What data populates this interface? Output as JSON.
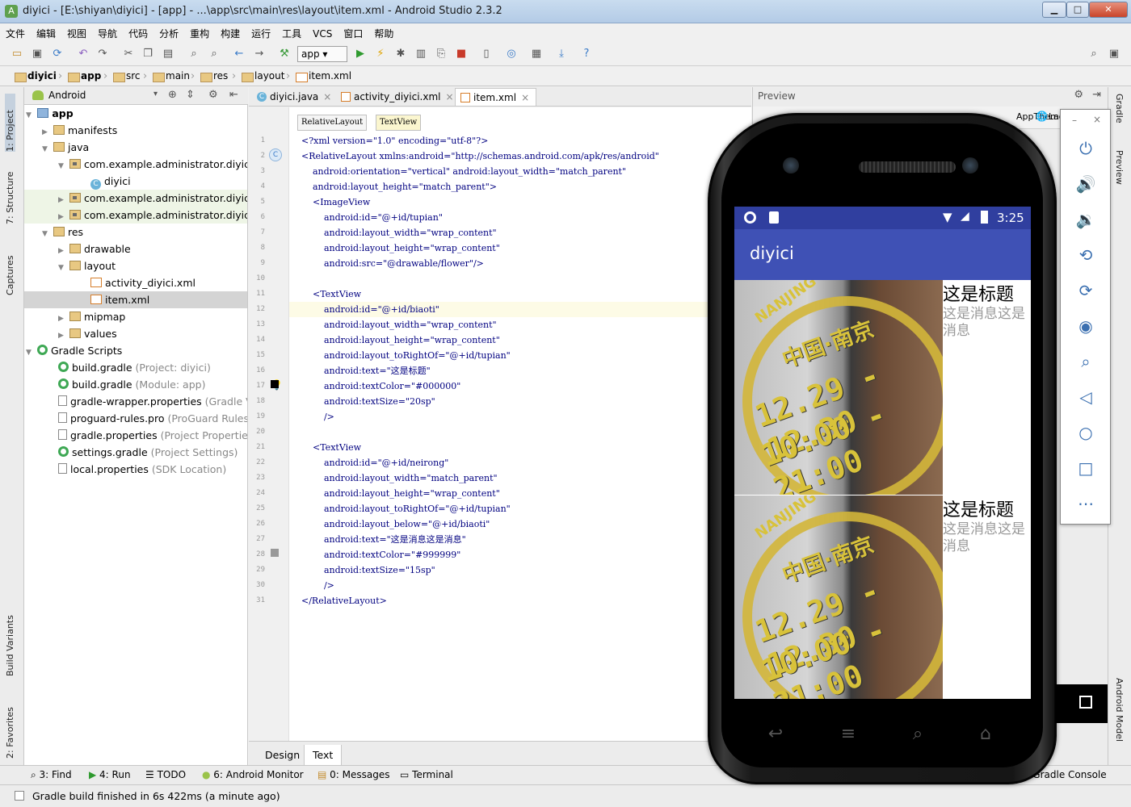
{
  "window": {
    "title": "diyici - [E:\\shiyan\\diyici] - [app] - ...\\app\\src\\main\\res\\layout\\item.xml - Android Studio 2.3.2"
  },
  "menu": [
    "文件",
    "编辑",
    "视图",
    "导航",
    "代码",
    "分析",
    "重构",
    "构建",
    "运行",
    "工具",
    "VCS",
    "窗口",
    "帮助"
  ],
  "toolbar": {
    "run_config": "app"
  },
  "breadcrumbs": [
    "diyici",
    "app",
    "src",
    "main",
    "res",
    "layout",
    "item.xml"
  ],
  "left_strip": [
    "1: Project",
    "7: Structure",
    "Captures",
    "Build Variants",
    "2: Favorites"
  ],
  "project_panel": {
    "view_mode": "Android",
    "tree": [
      {
        "label": "app",
        "hint": ""
      },
      {
        "label": "manifests",
        "hint": ""
      },
      {
        "label": "java",
        "hint": ""
      },
      {
        "label": "com.example.administrator.diyici",
        "hint": ""
      },
      {
        "label": "diyici",
        "hint": ""
      },
      {
        "label": "com.example.administrator.diyici",
        "hint": ""
      },
      {
        "label": "com.example.administrator.diyici",
        "hint": ""
      },
      {
        "label": "res",
        "hint": ""
      },
      {
        "label": "drawable",
        "hint": ""
      },
      {
        "label": "layout",
        "hint": ""
      },
      {
        "label": "activity_diyici.xml",
        "hint": ""
      },
      {
        "label": "item.xml",
        "hint": ""
      },
      {
        "label": "mipmap",
        "hint": ""
      },
      {
        "label": "values",
        "hint": ""
      },
      {
        "label": "Gradle Scripts",
        "hint": ""
      },
      {
        "label": "build.gradle",
        "hint": "(Project: diyici)"
      },
      {
        "label": "build.gradle",
        "hint": "(Module: app)"
      },
      {
        "label": "gradle-wrapper.properties",
        "hint": "(Gradle V"
      },
      {
        "label": "proguard-rules.pro",
        "hint": "(ProGuard Rules"
      },
      {
        "label": "gradle.properties",
        "hint": "(Project Properties)"
      },
      {
        "label": "settings.gradle",
        "hint": "(Project Settings)"
      },
      {
        "label": "local.properties",
        "hint": "(SDK Location)"
      }
    ]
  },
  "editor_tabs": [
    "diyici.java",
    "activity_diyici.xml",
    "item.xml"
  ],
  "editor_crumbs": [
    "RelativeLayout",
    "TextView"
  ],
  "code_lines": [
    "<?xml version=\"1.0\" encoding=\"utf-8\"?>",
    "<RelativeLayout xmlns:android=\"http://schemas.android.com/apk/res/android\"",
    "    android:orientation=\"vertical\" android:layout_width=\"match_parent\"",
    "    android:layout_height=\"match_parent\">",
    "    <ImageView",
    "        android:id=\"@+id/tupian\"",
    "        android:layout_width=\"wrap_content\"",
    "        android:layout_height=\"wrap_content\"",
    "        android:src=\"@drawable/flower\"/>",
    "",
    "    <TextView",
    "        android:id=\"@+id/biaoti\"",
    "        android:layout_width=\"wrap_content\"",
    "        android:layout_height=\"wrap_content\"",
    "        android:layout_toRightOf=\"@+id/tupian\"",
    "        android:text=\"这是标题\"",
    "        android:textColor=\"#000000\"",
    "        android:textSize=\"20sp\"",
    "        />",
    "",
    "    <TextView",
    "        android:id=\"@+id/neirong\"",
    "        android:layout_width=\"match_parent\"",
    "        android:layout_height=\"wrap_content\"",
    "        android:layout_toRightOf=\"@+id/tupian\"",
    "        android:layout_below=\"@+id/biaoti\"",
    "        android:text=\"这是消息这是消息\"",
    "        android:textColor=\"#999999\"",
    "        android:textSize=\"15sp\"",
    "        />",
    "</RelativeLayout>"
  ],
  "editor_bottom_tabs": [
    "Design",
    "Text"
  ],
  "preview": {
    "title": "Preview",
    "theme_label": "AppTheme",
    "lang_label": "Lan"
  },
  "right_strip": [
    "Gradle",
    "Preview",
    "Android Model"
  ],
  "bottom_tools": [
    "3: Find",
    "4: Run",
    "TODO",
    "6: Android Monitor",
    "0: Messages",
    "Terminal",
    "Gradle Console"
  ],
  "status": {
    "message": "Gradle build finished in 6s 422ms (a minute ago)"
  },
  "device": {
    "time": "3:25",
    "app_title": "diyici",
    "items": [
      {
        "title": "这是标题",
        "message": "这是消息这是消息"
      },
      {
        "title": "这是标题",
        "message": "这是消息这是消息"
      }
    ],
    "stamp": {
      "line1": "中国·南京",
      "line2": "12.29 - 12.30",
      "line3": "10:00 - 21:00",
      "arc": "NANJING"
    }
  },
  "colors": {
    "status_bar": "#303f9f",
    "app_bar": "#3f51b5",
    "title_text": "#000000",
    "message_text": "#999999"
  }
}
